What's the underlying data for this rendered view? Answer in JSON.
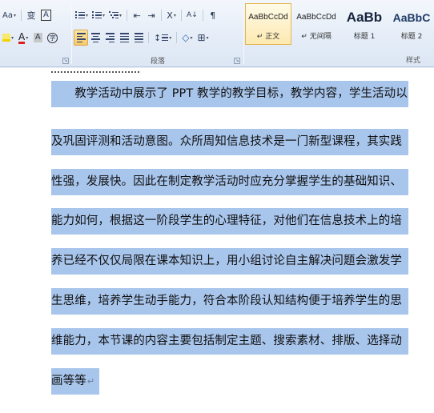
{
  "ribbon": {
    "font_size_btn": "Aa",
    "phonetic_btn": "变",
    "charborder_btn": "A",
    "row2": {
      "highlight_btn": "ab",
      "fontcolor_btn": "A",
      "charshade_btn": "A",
      "enclose_btn": "字"
    },
    "para_icons": {
      "sort_btn": "A↓",
      "pilcrow_btn": "¶",
      "decrease_indent": "⇤",
      "increase_indent": "⇥",
      "chinese_layout": "X",
      "line_spacing": "↕",
      "shading": "◇",
      "borders": "⊞"
    },
    "paragraph_group_label": "段落",
    "styles_group_label": "样式",
    "styles": [
      {
        "sample": "AaBbCcDd",
        "name": "↵ 正文"
      },
      {
        "sample": "AaBbCcDd",
        "name": "↵ 无间隔"
      },
      {
        "sample": "AaBb",
        "name": "标题 1"
      },
      {
        "sample": "AaBbC",
        "name": "标题 2"
      }
    ]
  },
  "document": {
    "lines": [
      "　　教学活动中展示了 PPT 教学的教学目标，教学内容，学生活动以",
      "及巩固评测和活动意图。众所周知信息技术是一门新型课程，其实践",
      "性强，发展快。因此在制定教学活动时应充分掌握学生的基础知识、",
      "能力如何，根据这一阶段学生的心理特征，对他们在信息技术上的培",
      "养已经不仅仅局限在课本知识上，用小组讨论自主解决问题会激发学",
      "生思维，培养学生动手能力，符合本阶段认知结构便于培养学生的思",
      "维能力，本节课的内容主要包括制定主题、搜索素材、排版、选择动",
      "画等等"
    ],
    "end_mark": "↵",
    "selection_color": "#a8c5ec"
  }
}
